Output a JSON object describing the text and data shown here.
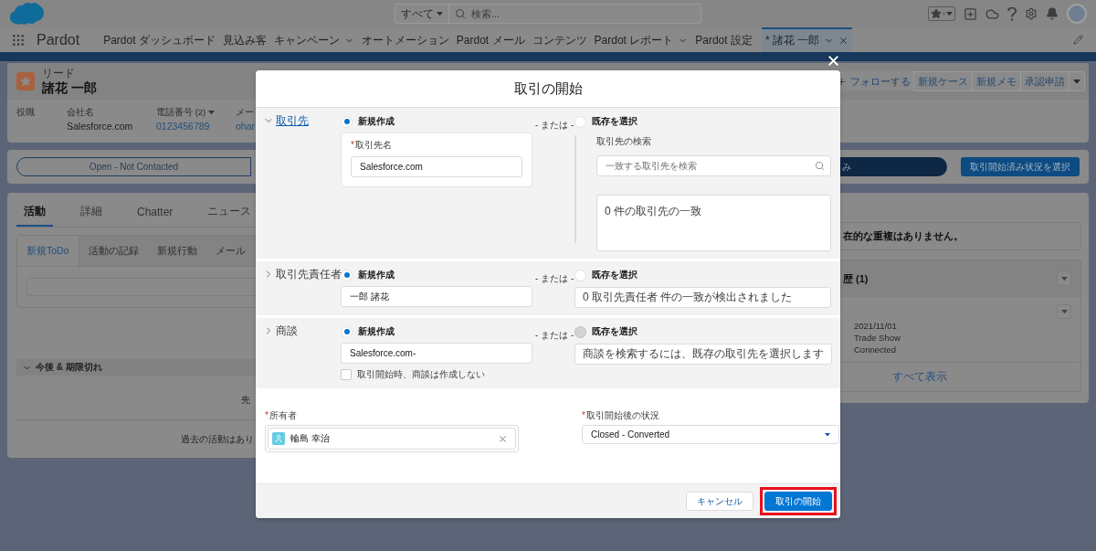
{
  "header": {
    "search_scope": "すべて",
    "search_placeholder": "検索..."
  },
  "nav": {
    "app_name": "Pardot",
    "tabs": [
      {
        "label": "Pardot ダッシュボード",
        "selected": false,
        "menu": false,
        "closable": false
      },
      {
        "label": "見込み客",
        "selected": false,
        "menu": false,
        "closable": false
      },
      {
        "label": "キャンペーン",
        "selected": false,
        "menu": true,
        "closable": false
      },
      {
        "label": "オートメーション",
        "selected": false,
        "menu": false,
        "closable": false
      },
      {
        "label": "Pardot メール",
        "selected": false,
        "menu": false,
        "closable": false
      },
      {
        "label": "コンテンツ",
        "selected": false,
        "menu": false,
        "closable": false
      },
      {
        "label": "Pardot レポート",
        "selected": false,
        "menu": true,
        "closable": false
      },
      {
        "label": "Pardot 設定",
        "selected": false,
        "menu": false,
        "closable": false
      },
      {
        "label": "* 諸花 一郎",
        "selected": true,
        "menu": true,
        "closable": true
      }
    ]
  },
  "record": {
    "type": "リード",
    "name": "諸花 一郎",
    "actions": [
      {
        "kind": "follow",
        "label": "フォローする"
      },
      {
        "kind": "plain",
        "label": "新規ケース"
      },
      {
        "kind": "plain",
        "label": "新規メモ"
      },
      {
        "kind": "plain",
        "label": "承認申請"
      },
      {
        "kind": "menu"
      }
    ],
    "fields": [
      {
        "label": "役職"
      },
      {
        "label": "会社名",
        "value": "Salesforce.com",
        "kind": "text"
      },
      {
        "label": "電話番号 (2)",
        "value": "0123456789",
        "kind": "link",
        "menu": true
      },
      {
        "label": "メー",
        "value": "ohar",
        "kind": "link"
      }
    ]
  },
  "path": {
    "stages": [
      {
        "label": "Open - Not Contacted",
        "selected": false
      },
      {
        "label": "み",
        "selected": true
      }
    ],
    "button": "取引開始済み状況を選択"
  },
  "activity": {
    "tabs": [
      {
        "label": "活動",
        "selected": true
      },
      {
        "label": "詳細",
        "selected": false
      },
      {
        "label": "Chatter",
        "selected": false
      },
      {
        "label": "ニュース",
        "selected": false
      }
    ],
    "subtabs": [
      {
        "label": "新規ToDo",
        "selected": true
      },
      {
        "label": "活動の記録",
        "selected": false
      },
      {
        "label": "新規行動",
        "selected": false
      },
      {
        "label": "メール",
        "selected": false
      }
    ],
    "section": "今後 & 期限切れ",
    "section_expanded": true,
    "note": "先",
    "past_note": "過去の活動はあり"
  },
  "sidebar": {
    "duplicates": "在的な重複はありません。",
    "history": {
      "title": "歴 (1)",
      "items": [
        {
          "lines": [
            "2021/11/01",
            "Trade Show",
            "Connected"
          ]
        }
      ],
      "view_all": "すべて表示"
    }
  },
  "modal": {
    "title": "取引の開始",
    "sections": [
      {
        "title": "取引先",
        "expanded": true,
        "new": {
          "label": "新規作成",
          "selected": true
        },
        "new_field": {
          "required_mark": "*",
          "label": "取引先名",
          "value": "Salesforce.com"
        },
        "or_text": "- または -",
        "existing": {
          "label": "既存を選択",
          "selected": false,
          "disabled": false
        },
        "search": {
          "label": "取引先の検索",
          "placeholder": "一致する取引先を検索"
        },
        "result": "0 件の取引先の一致"
      },
      {
        "title": "取引先責任者",
        "expanded": false,
        "new": {
          "label": "新規作成",
          "selected": true
        },
        "new_field": {
          "value": "一郎 諸花"
        },
        "or_text": "- または -",
        "existing": {
          "label": "既存を選択",
          "selected": false,
          "disabled": false
        },
        "result": "0 取引先責任者 件の一致が検出されました"
      },
      {
        "title": "商談",
        "expanded": false,
        "new": {
          "label": "新規作成",
          "selected": true
        },
        "new_field": {
          "value": "Salesforce.com-"
        },
        "option_checkbox": {
          "label": "取引開始時、商談は作成しない",
          "checked": false
        },
        "or_text": "- または -",
        "existing": {
          "label": "既存を選択",
          "selected": false,
          "disabled": true
        },
        "result": "商談を検索するには、既存の取引先を選択します"
      }
    ],
    "owner": {
      "required_mark": "*",
      "label": "所有者",
      "value": "輪島 幸治"
    },
    "status": {
      "required_mark": "*",
      "label": "取引開始後の状況",
      "value": "Closed - Converted"
    },
    "buttons": [
      {
        "kind": "neutral",
        "label": "キャンセル",
        "highlighted": false
      },
      {
        "kind": "brand",
        "label": "取引の開始",
        "highlighted": true
      }
    ]
  }
}
